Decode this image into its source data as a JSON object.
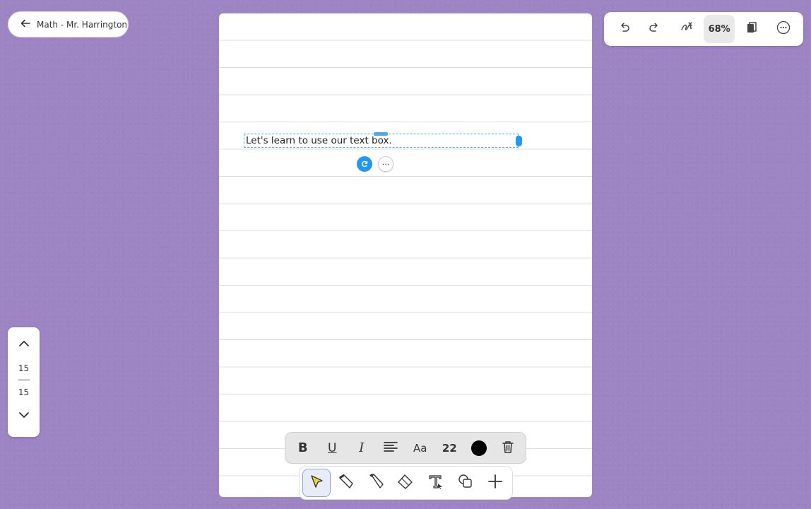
{
  "header": {
    "back_label": "Math - Mr. Harrington"
  },
  "topbar": {
    "zoom": "68%"
  },
  "canvas": {
    "textbox_text": "Let's learn to use our text box."
  },
  "pager": {
    "current": "15",
    "total": "15"
  },
  "format_bar": {
    "bold": "B",
    "underline": "U",
    "italic": "I",
    "font": "Aa",
    "font_size": "22",
    "text_color": "#000000"
  },
  "tools": [
    "select-tool",
    "pen-tool",
    "marker-tool",
    "eraser-tool",
    "text-tool",
    "shape-tool",
    "add-tool"
  ],
  "colors": {
    "background": "#9d85c4",
    "accent": "#2196f3"
  }
}
